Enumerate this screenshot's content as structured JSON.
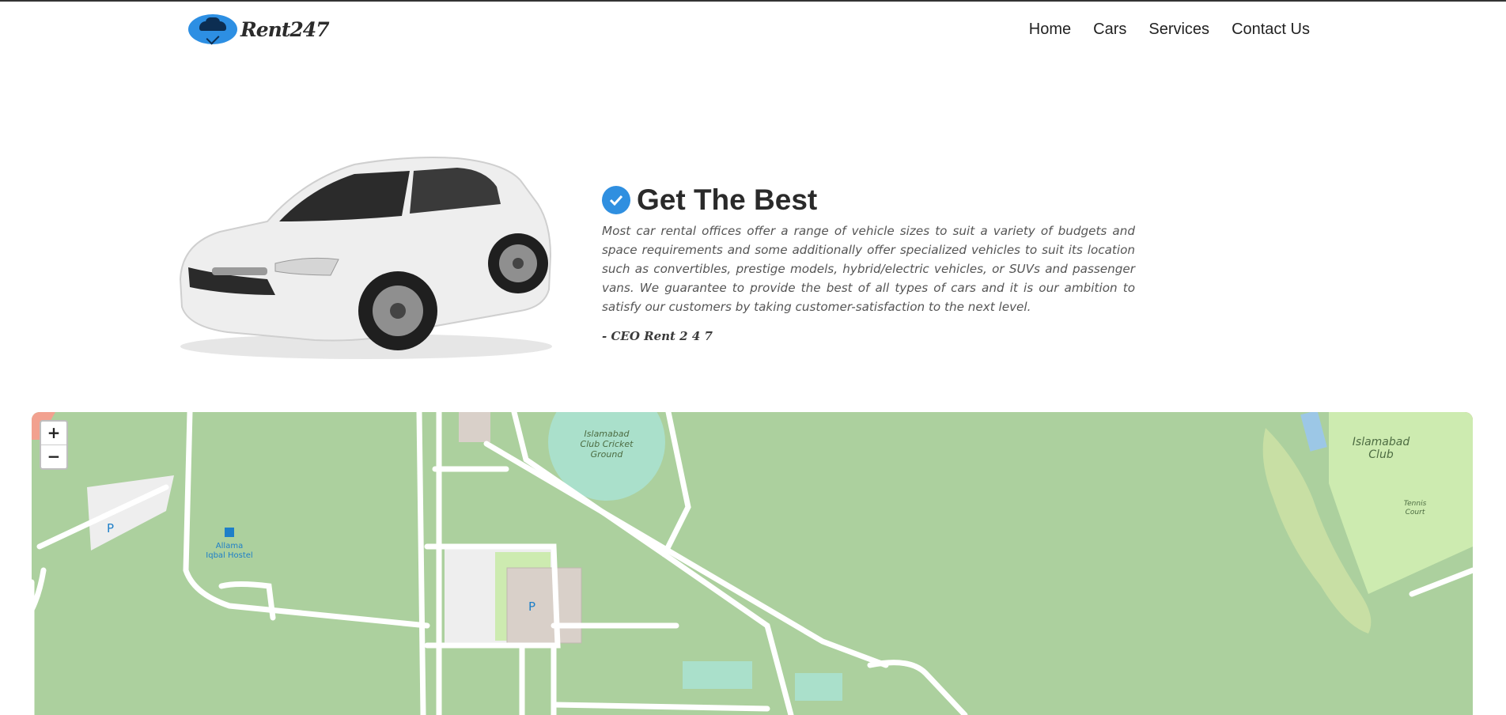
{
  "header": {
    "brand": "Rent247",
    "nav": [
      "Home",
      "Cars",
      "Services",
      "Contact Us"
    ]
  },
  "feature": {
    "title": "Get The Best",
    "description": "Most car rental offices offer a range of vehicle sizes to suit a variety of budgets and space requirements and some additionally offer specialized vehicles to suit its location such as convertibles, prestige models, hybrid/electric vehicles, or SUVs and passenger vans. We guarantee to provide the best of all types of cars and it is our ambition to satisfy our customers by taking customer-satisfaction to the next level.",
    "signature": "- CEO Rent 2 4 7"
  },
  "map": {
    "zoom_in": "+",
    "zoom_out": "−",
    "labels": {
      "cricket_ground": [
        "Islamabad",
        "Club Cricket",
        "Ground"
      ],
      "club": [
        "Islamabad",
        "Club"
      ],
      "hostel": [
        "Allama",
        "Iqbal Hostel"
      ],
      "tennis": [
        "Tennis",
        "Court"
      ],
      "parking": "P"
    }
  },
  "colors": {
    "accent": "#2f8fe0",
    "map_park": "#acd09e",
    "map_road": "#ffffff",
    "map_pitch": "#aae0cb"
  }
}
